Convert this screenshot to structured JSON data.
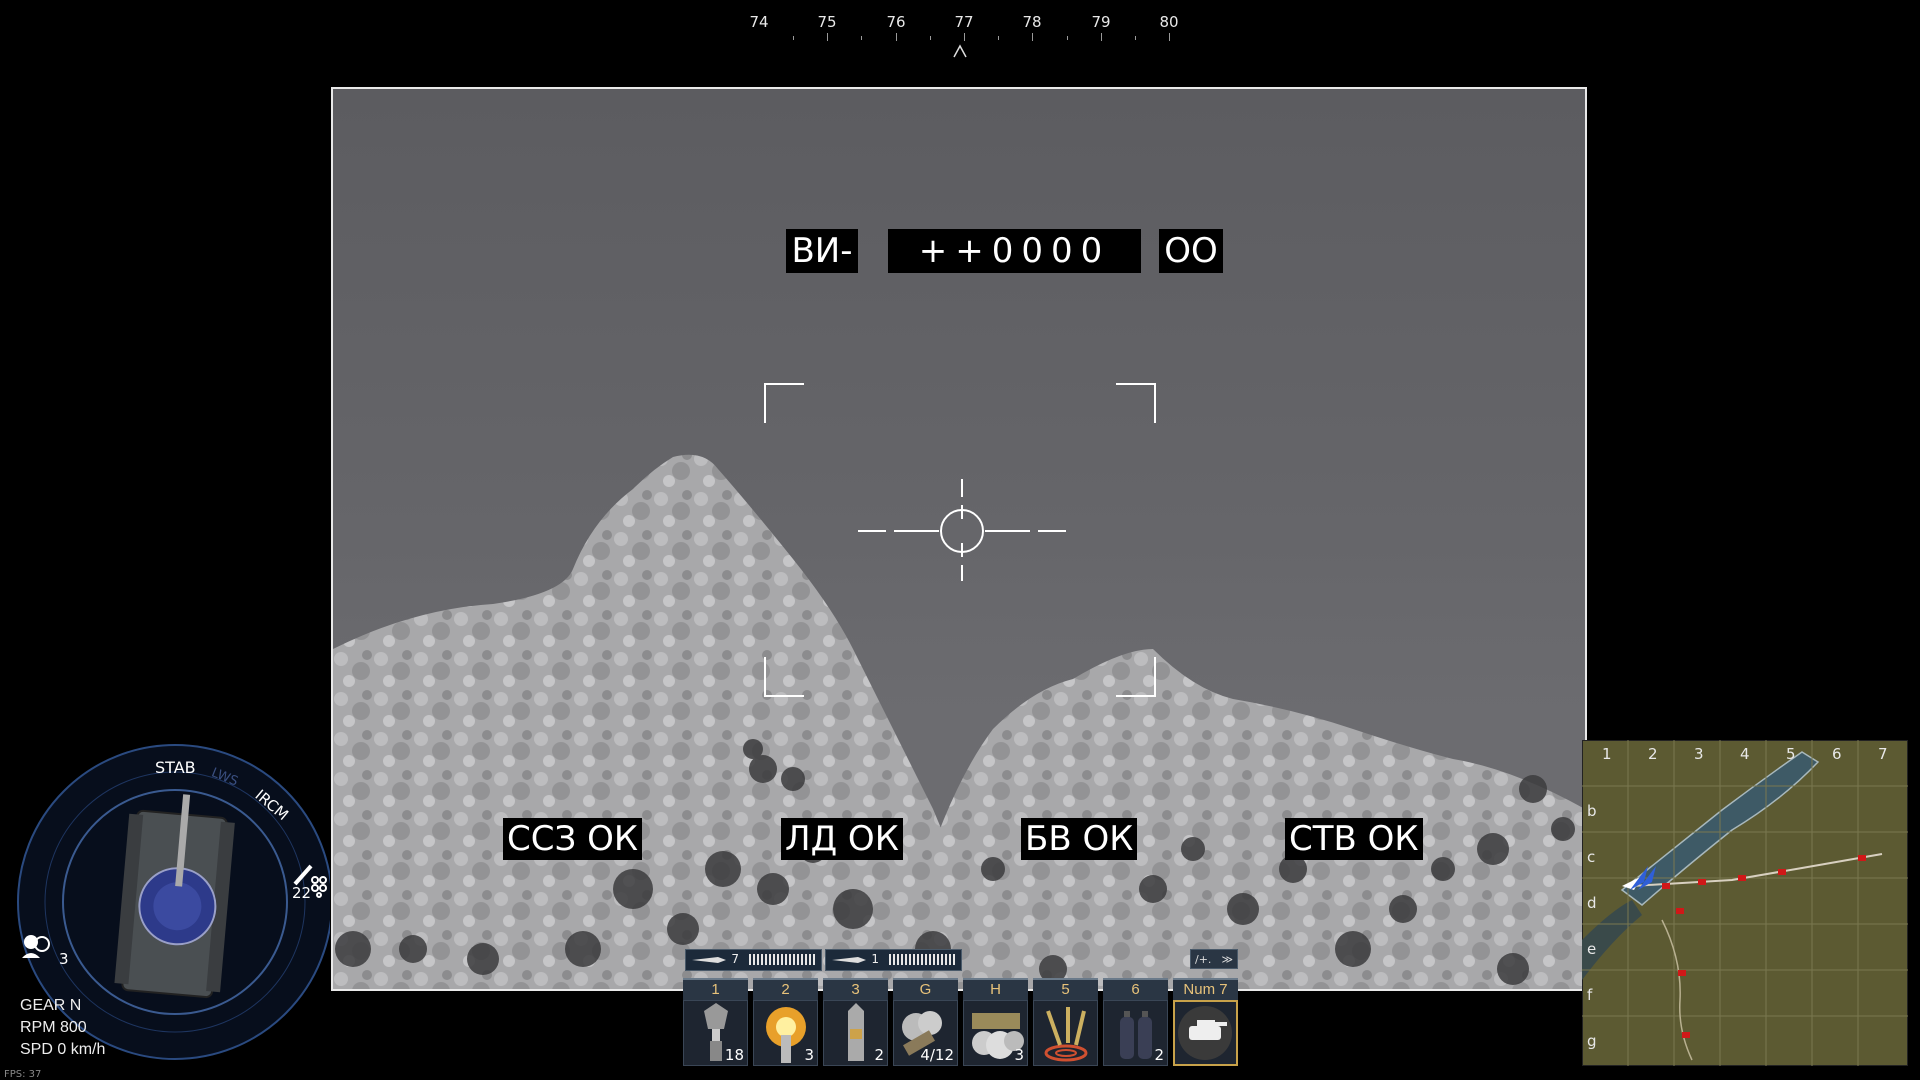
{
  "compass": {
    "labels": [
      "74",
      "75",
      "76",
      "77",
      "78",
      "79",
      "80"
    ]
  },
  "sight": {
    "mode_label": "ВИ-",
    "rangefinder_value": "++0000",
    "aux_value": "ОО",
    "systems": [
      "ССЗ ОК",
      "ЛД ОК",
      "БВ ОК",
      "СТВ ОК"
    ]
  },
  "dial": {
    "stab_label": "STAB",
    "lws_label": "LWS",
    "ircm_label": "IRCM",
    "crew_count": "3",
    "rockets_count": "22"
  },
  "status": {
    "gear": "GEAR N",
    "rpm": "RPM 800",
    "speed": "SPD 0 km/h"
  },
  "fps": "FPS: 37",
  "ammo_bars": [
    {
      "count": "7"
    },
    {
      "count": "1"
    }
  ],
  "ammo_bar_toggle": "/+.",
  "action_bar": [
    {
      "key": "1",
      "icon": "apfsds-shell-icon",
      "count": "18"
    },
    {
      "key": "2",
      "icon": "he-shell-icon",
      "count": "3"
    },
    {
      "key": "3",
      "icon": "heat-shell-icon",
      "count": "2"
    },
    {
      "key": "G",
      "icon": "smoke-grenade-icon",
      "count": "4/12"
    },
    {
      "key": "H",
      "icon": "smoke-screen-icon",
      "count": "3"
    },
    {
      "key": "5",
      "icon": "artillery-strike-icon",
      "count": ""
    },
    {
      "key": "6",
      "icon": "fire-extinguisher-icon",
      "count": "2"
    },
    {
      "key": "Num 7",
      "icon": "scout-tank-icon",
      "count": ""
    }
  ],
  "minimap": {
    "columns": [
      "1",
      "2",
      "3",
      "4",
      "5",
      "6",
      "7"
    ],
    "rows": [
      "b",
      "c",
      "d",
      "e",
      "f",
      "g"
    ]
  },
  "colors": {
    "key_text": "#e7c27a",
    "enemy_marker": "#d01818",
    "player_marker": "#2f5fd8"
  }
}
